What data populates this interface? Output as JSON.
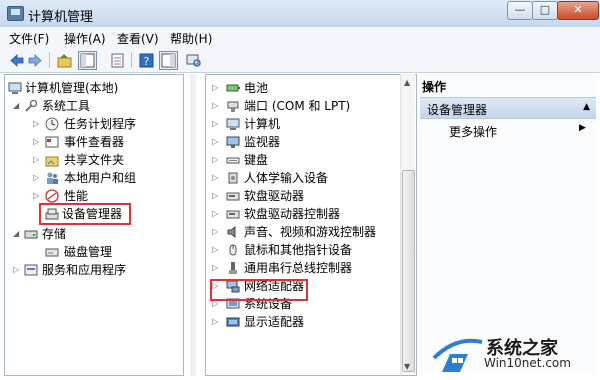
{
  "window": {
    "title": "计算机管理",
    "min": "—",
    "max": "□",
    "close": "✕"
  },
  "menubar": [
    {
      "label": "文件(F)"
    },
    {
      "label": "操作(A)"
    },
    {
      "label": "查看(V)"
    },
    {
      "label": "帮助(H)"
    }
  ],
  "toolbar": {
    "icons": [
      "back-arrow-icon",
      "forward-arrow-icon",
      "up-folder-icon",
      "show-tree-icon",
      "properties-icon",
      "help-icon",
      "show-action-pane-icon",
      "scan-hardware-icon"
    ]
  },
  "left_tree": {
    "root": "计算机管理(本地)",
    "system_tools": "系统工具",
    "task_scheduler": "任务计划程序",
    "event_viewer": "事件查看器",
    "shared_folders": "共享文件夹",
    "local_users": "本地用户和组",
    "performance": "性能",
    "device_manager": "设备管理器",
    "storage": "存储",
    "disk_management": "磁盘管理",
    "services_apps": "服务和应用程序"
  },
  "devices": [
    {
      "label": "电池",
      "icon": "battery-icon"
    },
    {
      "label": "端口 (COM 和 LPT)",
      "icon": "port-icon"
    },
    {
      "label": "计算机",
      "icon": "computer-icon"
    },
    {
      "label": "监视器",
      "icon": "monitor-icon"
    },
    {
      "label": "键盘",
      "icon": "keyboard-icon"
    },
    {
      "label": "人体学输入设备",
      "icon": "hid-icon"
    },
    {
      "label": "软盘驱动器",
      "icon": "floppy-drive-icon"
    },
    {
      "label": "软盘驱动器控制器",
      "icon": "floppy-controller-icon"
    },
    {
      "label": "声音、视频和游戏控制器",
      "icon": "sound-icon"
    },
    {
      "label": "鼠标和其他指针设备",
      "icon": "mouse-icon"
    },
    {
      "label": "通用串行总线控制器",
      "icon": "usb-icon"
    },
    {
      "label": "网络适配器",
      "icon": "network-adapter-icon"
    },
    {
      "label": "系统设备",
      "icon": "system-device-icon"
    },
    {
      "label": "显示适配器",
      "icon": "display-adapter-icon"
    }
  ],
  "actions": {
    "header": "操作",
    "selected": "设备管理器",
    "more": "更多操作"
  },
  "watermark": {
    "line1": "系统之家",
    "line2": "Win10net.com"
  },
  "colors": {
    "highlight_box": "#d33333",
    "title_bar": "#c4d8ee"
  }
}
